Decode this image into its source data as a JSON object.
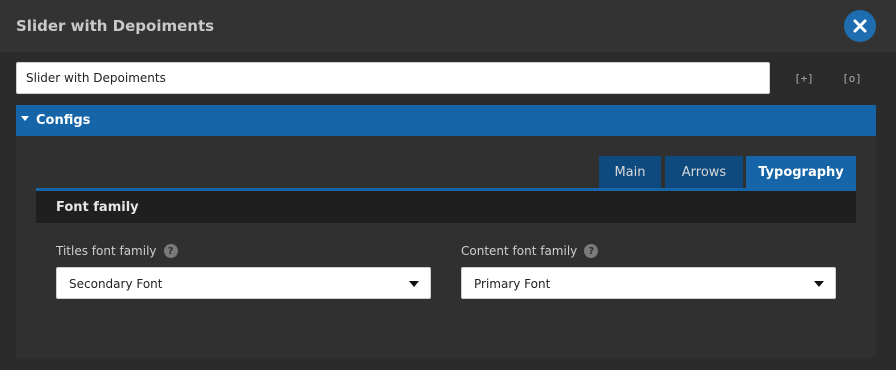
{
  "dialog": {
    "title": "Slider with Depoiments",
    "close_icon": "close-icon"
  },
  "name_field": {
    "value": "Slider with Depoiments"
  },
  "toolbar": {
    "expand_label": "[+]",
    "preview_label": "[o]"
  },
  "configs": {
    "label": "Configs",
    "expanded": true
  },
  "tabs": [
    {
      "label": "Main",
      "active": false
    },
    {
      "label": "Arrows",
      "active": false
    },
    {
      "label": "Typography",
      "active": true
    }
  ],
  "section": {
    "title": "Font family"
  },
  "fields": {
    "titles_font": {
      "label": "Titles font family",
      "value": "Secondary Font",
      "help": "?"
    },
    "content_font": {
      "label": "Content font family",
      "value": "Primary Font",
      "help": "?"
    }
  },
  "colors": {
    "accent": "#1565a8",
    "tab_inactive": "#0e4a7d",
    "close_button": "#1e6db0"
  }
}
